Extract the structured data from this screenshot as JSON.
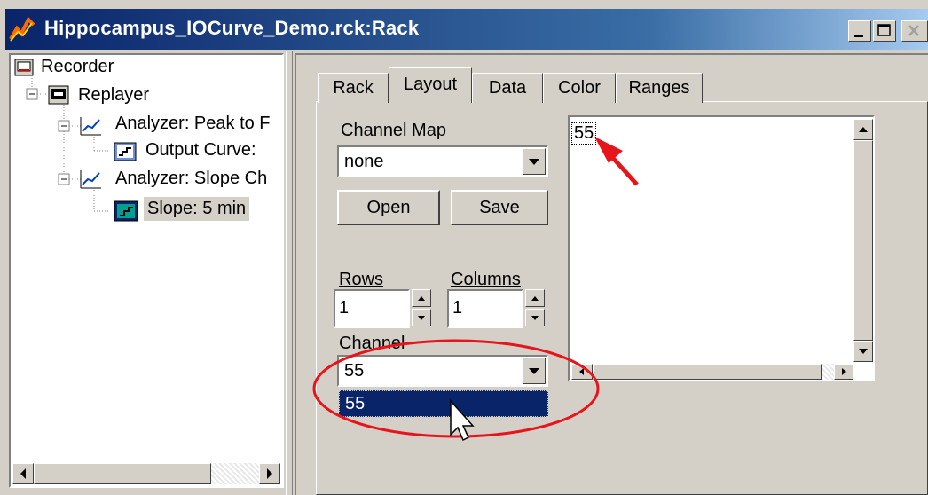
{
  "window": {
    "title": "Hippocampus_IOCurve_Demo.rck:Rack"
  },
  "tree": {
    "items": [
      {
        "label": "Recorder",
        "icon": "recorder-icon"
      },
      {
        "label": "Replayer",
        "icon": "replayer-icon"
      },
      {
        "label": "Analyzer: Peak to F",
        "icon": "analyzer-icon"
      },
      {
        "label": "Output Curve:",
        "icon": "output-curve-icon"
      },
      {
        "label": "Analyzer: Slope Ch",
        "icon": "analyzer-icon"
      },
      {
        "label": "Slope: 5 min",
        "icon": "slope-icon"
      }
    ]
  },
  "tabs": [
    {
      "label": "Rack"
    },
    {
      "label": "Layout"
    },
    {
      "label": "Data"
    },
    {
      "label": "Color"
    },
    {
      "label": "Ranges"
    }
  ],
  "layout": {
    "channel_map_label": "Channel Map",
    "channel_map_value": "none",
    "open_label": "Open",
    "save_label": "Save",
    "rows_label": "Rows",
    "rows_value": "1",
    "columns_label": "Columns",
    "columns_value": "1",
    "channel_label": "Channel",
    "channel_value": "55",
    "channel_options": [
      "55"
    ],
    "grid_cell": "55"
  },
  "colors": {
    "title_start": "#0a246a",
    "title_end": "#a6caf0",
    "selection": "#0a246a",
    "annotation": "#e8141b"
  }
}
